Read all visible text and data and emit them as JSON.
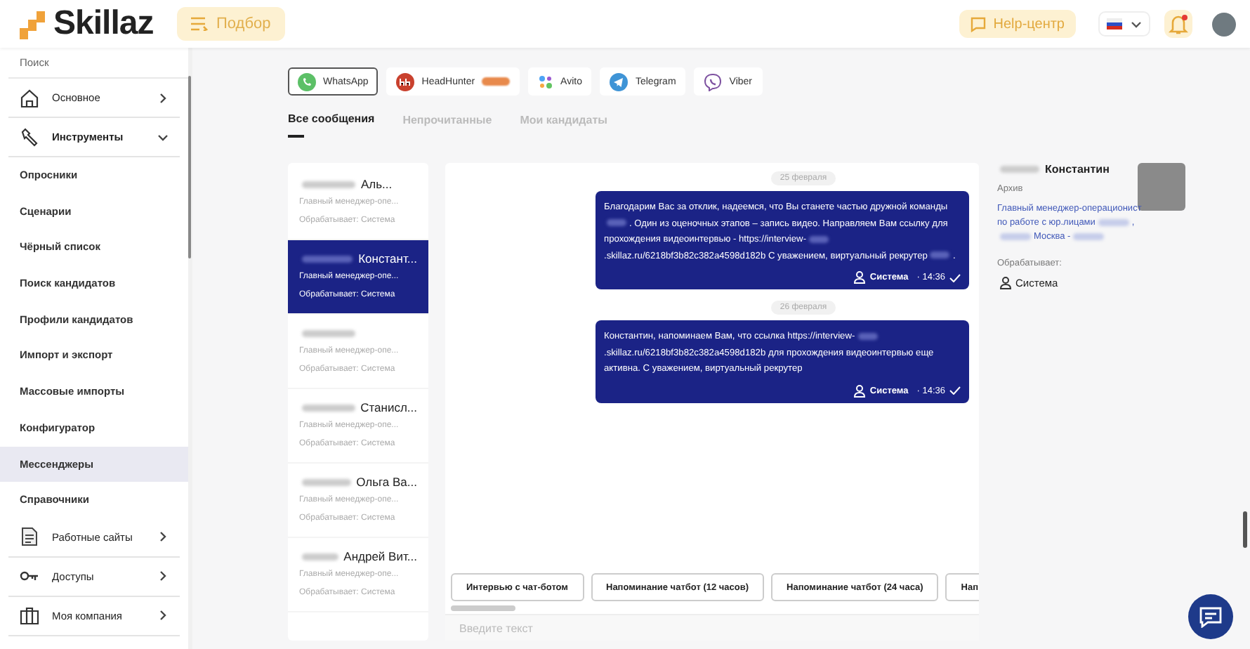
{
  "header": {
    "logo": "Skillaz",
    "nav_button": "Подбор",
    "help_button": "Help-центр"
  },
  "sidebar": {
    "search_label": "Поиск",
    "items": [
      {
        "label": "Основное",
        "kind": "group",
        "expanded": false,
        "selected": false
      },
      {
        "label": "Инструменты",
        "kind": "group",
        "expanded": true,
        "selected": false
      },
      {
        "label": "Опросники",
        "kind": "sub",
        "selected": false
      },
      {
        "label": "Сценарии",
        "kind": "sub",
        "selected": false
      },
      {
        "label": "Чёрный список",
        "kind": "sub",
        "selected": false
      },
      {
        "label": "Поиск кандидатов",
        "kind": "sub",
        "selected": false
      },
      {
        "label": "Профили кандидатов",
        "kind": "sub",
        "selected": false
      },
      {
        "label": "Импорт и экспорт",
        "kind": "sub",
        "selected": false
      },
      {
        "label": "Массовые импорты",
        "kind": "sub",
        "selected": false
      },
      {
        "label": "Конфигуратор",
        "kind": "sub",
        "selected": false
      },
      {
        "label": "Мессенджеры",
        "kind": "sub",
        "selected": true
      },
      {
        "label": "Справочники",
        "kind": "sub",
        "selected": false
      },
      {
        "label": "Работные сайты",
        "kind": "group",
        "expanded": false,
        "selected": false
      },
      {
        "label": "Доступы",
        "kind": "group",
        "expanded": false,
        "selected": false
      },
      {
        "label": "Моя компания",
        "kind": "group",
        "expanded": false,
        "selected": false
      }
    ]
  },
  "channels": [
    {
      "label": "WhatsApp",
      "selected": true,
      "badge": false
    },
    {
      "label": "HeadHunter",
      "selected": false,
      "badge": true
    },
    {
      "label": "Avito",
      "selected": false,
      "badge": false
    },
    {
      "label": "Telegram",
      "selected": false,
      "badge": false
    },
    {
      "label": "Viber",
      "selected": false,
      "badge": false
    }
  ],
  "tabs": [
    {
      "label": "Все сообщения",
      "selected": true
    },
    {
      "label": "Непрочитанные",
      "selected": false
    },
    {
      "label": "Мои кандидаты",
      "selected": false
    }
  ],
  "chats": [
    {
      "name": "Аль...",
      "role": "Главный менеджер-опе...",
      "handler": "Обрабатывает: Система",
      "selected": false
    },
    {
      "name": "Констант...",
      "role": "Главный менеджер-опе...",
      "handler": "Обрабатывает: Система",
      "selected": true
    },
    {
      "role": "Главный менеджер-опе...",
      "handler": "Обрабатывает: Система",
      "selected": false
    },
    {
      "name": "Станисл...",
      "role": "Главный менеджер-опе...",
      "handler": "Обрабатывает: Система",
      "selected": false
    },
    {
      "name": "Ольга Ва...",
      "role": "Главный менеджер-опе...",
      "handler": "Обрабатывает: Система",
      "selected": false
    },
    {
      "name": "Андрей Вит...",
      "role": "Главный менеджер-опе...",
      "handler": "Обрабатывает: Система",
      "selected": false
    }
  ],
  "messages": [
    {
      "date": "25 февраля",
      "parts": [
        "Благодарим Вас за отклик, надеемся, что Вы станете частью дружной команды",
        ". Один из оценочных этапов – запись видео. Направляем Вам ссылку для прохождения видеоинтервью - https://interview-",
        ".skillaz.ru/6218bf3b82c382a4598d182b С уважением, виртуальный рекрутер",
        "."
      ],
      "author": "Система",
      "time": "· 14:36"
    },
    {
      "date": "26 февраля",
      "parts": [
        "Константин, напоминаем Вам, что ссылка https://interview-",
        ".skillaz.ru/6218bf3b82c382a4598d182b для прохождения видеоинтервью еще активна. С уважением, виртуальный рекрутер"
      ],
      "author": "Система",
      "time": "· 14:36"
    }
  ],
  "quick_replies": [
    "Интервью с чат-ботом",
    "Напоминание чатбот (12 часов)",
    "Напоминание чатбот (24 часа)",
    "Нап"
  ],
  "composer": {
    "placeholder": "Введите текст"
  },
  "profile": {
    "name": "Константин",
    "status": "Архив",
    "vacancy_parts": [
      "Главный менеджер-операционист по работе с юр.лицами",
      ",",
      "Москва -"
    ],
    "handler_label": "Обрабатывает:",
    "handler": "Система"
  }
}
